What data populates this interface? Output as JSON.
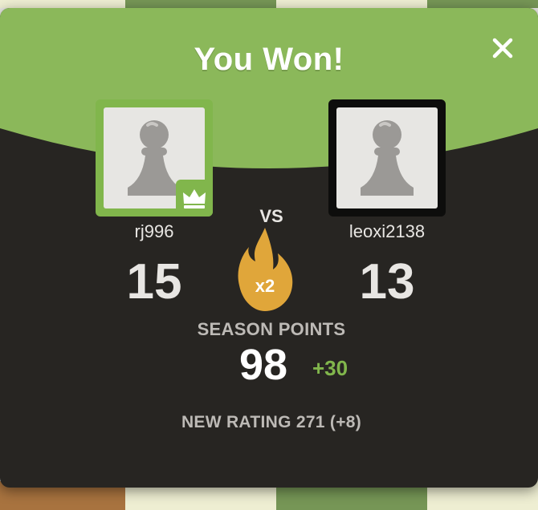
{
  "modal": {
    "title": "You Won!",
    "close_icon": "close-icon"
  },
  "players": {
    "left": {
      "username": "rj996",
      "score": "15",
      "avatar_icon": "pawn-icon",
      "badge_icon": "crown-icon"
    },
    "right": {
      "username": "leoxi2138",
      "score": "13",
      "avatar_icon": "pawn-icon"
    }
  },
  "vs_label": "VS",
  "streak": {
    "icon": "flame-icon",
    "multiplier": "x2"
  },
  "season": {
    "label": "SEASON POINTS",
    "value": "98",
    "delta": "+30"
  },
  "rating_text": "NEW RATING 271 (+8)",
  "colors": {
    "green": "#81b64c",
    "header_green": "#8bb85a",
    "dark": "#272522",
    "flame": "#e0a63a",
    "text_light": "#e8e6e3",
    "text_muted": "#bdbab6"
  }
}
